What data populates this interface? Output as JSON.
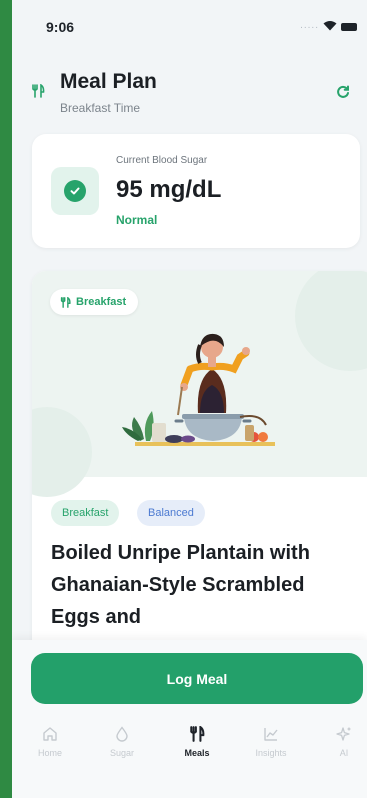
{
  "status_bar": {
    "time": "9:06",
    "signal": "....."
  },
  "header": {
    "title": "Meal Plan",
    "subtitle": "Breakfast Time"
  },
  "blood_sugar": {
    "label": "Current Blood Sugar",
    "value": "95 mg/dL",
    "status": "Normal"
  },
  "meal": {
    "type_chip": "Breakfast",
    "tags": [
      "Breakfast",
      "Balanced"
    ],
    "title": "Boiled Unripe Plantain with Ghanaian-Style Scrambled Eggs and"
  },
  "actions": {
    "log_meal": "Log Meal"
  },
  "tabs": [
    {
      "label": "Home",
      "icon": "home-icon",
      "active": false
    },
    {
      "label": "Sugar",
      "icon": "drop-icon",
      "active": false
    },
    {
      "label": "Meals",
      "icon": "fork-knife-icon",
      "active": true
    },
    {
      "label": "Insights",
      "icon": "chart-icon",
      "active": false
    },
    {
      "label": "AI",
      "icon": "sparkle-icon",
      "active": false
    }
  ],
  "colors": {
    "brand": "#23a06a",
    "frame": "#2f8a43",
    "accent_blue": "#4c7ad1"
  }
}
